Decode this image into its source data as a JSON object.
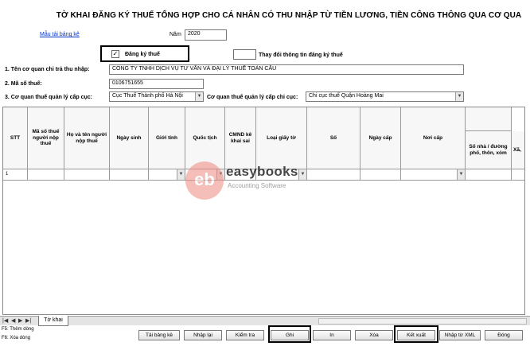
{
  "title": "TỜ KHAI ĐĂNG KÝ THUẾ TỔNG HỢP CHO CÁ NHÂN CÓ THU NHẬP TỪ TIỀN LƯƠNG, TIỀN CÔNG THÔNG QUA CƠ QUA",
  "form_link": "Mẫu tải bảng kê",
  "year": {
    "label": "Năm",
    "value": "2020"
  },
  "registration_checkbox": {
    "mark": "✓",
    "label": "Đăng ký thuế"
  },
  "change_checkbox": {
    "label": "Thay đổi thông tin đăng ký thuế"
  },
  "fields": {
    "payer_label": "1. Tên cơ quan chi trả thu nhập:",
    "payer_value": "CÔNG TY TNHH DỊCH VỤ TƯ VẤN VÀ ĐẠI LÝ THUẾ TOÀN CẦU",
    "tax_code_label": "2. Mã số thuế:",
    "tax_code_value": "0106751655",
    "dept_label": "3. Cơ quan thuế quản lý cấp cục:",
    "dept_value": "Cục Thuế Thành phố Hà Nội",
    "branch_label": "Cơ quan thuế quản lý cấp chi cục:",
    "branch_value": "Chi cục thuế Quận Hoàng Mai"
  },
  "table": {
    "columns": [
      "STT",
      "Mã số thuế người nộp thuế",
      "Họ và tên người nộp thuế",
      "Ngày sinh",
      "Giới tính",
      "Quốc tịch",
      "CMND kê khai sai",
      "Loại giấy tờ",
      "Số",
      "Ngày cấp",
      "Nơi cấp",
      "Số nhà / đường phố, thôn, xóm",
      "Xã,"
    ],
    "rows": [
      {
        "stt": "1"
      }
    ]
  },
  "sheet_tab": "Tờ khai",
  "shortcuts": [
    "F5: Thêm dòng",
    "F6: Xóa dòng"
  ],
  "buttons": [
    "Tải bảng kê",
    "Nhập lại",
    "Kiểm tra",
    "Ghi",
    "In",
    "Xóa",
    "Kết xuất",
    "Nhập từ XML",
    "Đóng"
  ],
  "watermark": {
    "logo": "eb",
    "brand": "easybooks",
    "tagline": "Accounting Software"
  },
  "colors": {
    "link": "#0033cc",
    "watermark_logo": "#f08a80"
  }
}
